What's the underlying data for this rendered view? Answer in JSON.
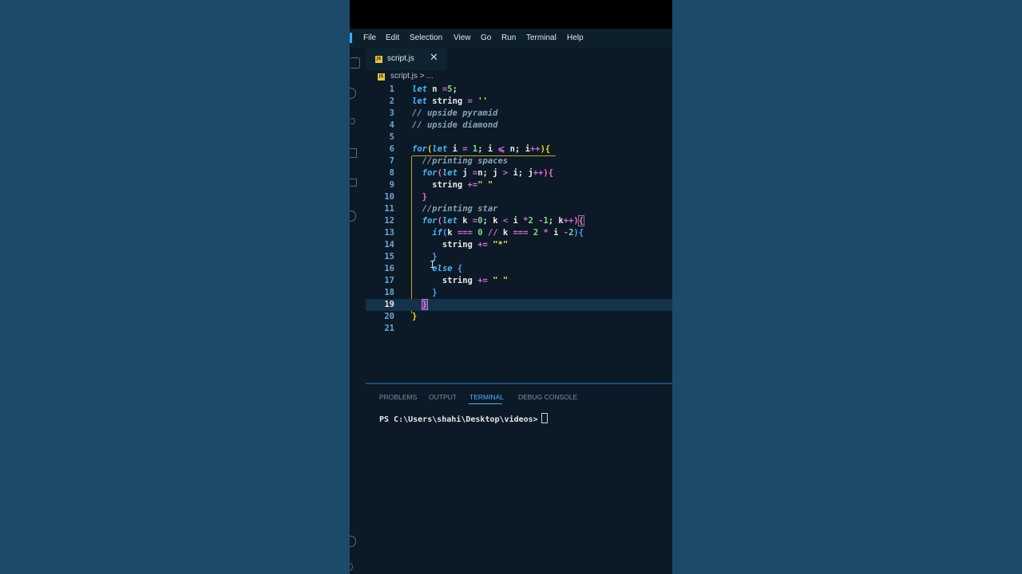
{
  "menubar": {
    "items": [
      "File",
      "Edit",
      "Selection",
      "View",
      "Go",
      "Run",
      "Terminal",
      "Help"
    ]
  },
  "tab": {
    "label": "script.js",
    "close": "✕",
    "icon": "js-file-icon"
  },
  "breadcrumb": {
    "file": "script.js",
    "separator": ">",
    "rest": "..."
  },
  "editor": {
    "current_line": 19,
    "line_numbers": [
      "1",
      "2",
      "3",
      "4",
      "5",
      "6",
      "7",
      "8",
      "9",
      "10",
      "11",
      "12",
      "13",
      "14",
      "15",
      "16",
      "17",
      "18",
      "19",
      "20",
      "21"
    ]
  },
  "panel": {
    "tabs": [
      "PROBLEMS",
      "OUTPUT",
      "TERMINAL",
      "DEBUG CONSOLE"
    ],
    "active_tab": "TERMINAL",
    "terminal_prompt": "PS C:\\Users\\shahi\\Desktop\\videos>"
  },
  "colors": {
    "editor_bg": "#0b1a26",
    "outer_bg": "#1b4a6b",
    "keyword": "#4fb4ff",
    "accent": "#4fb4ff"
  }
}
